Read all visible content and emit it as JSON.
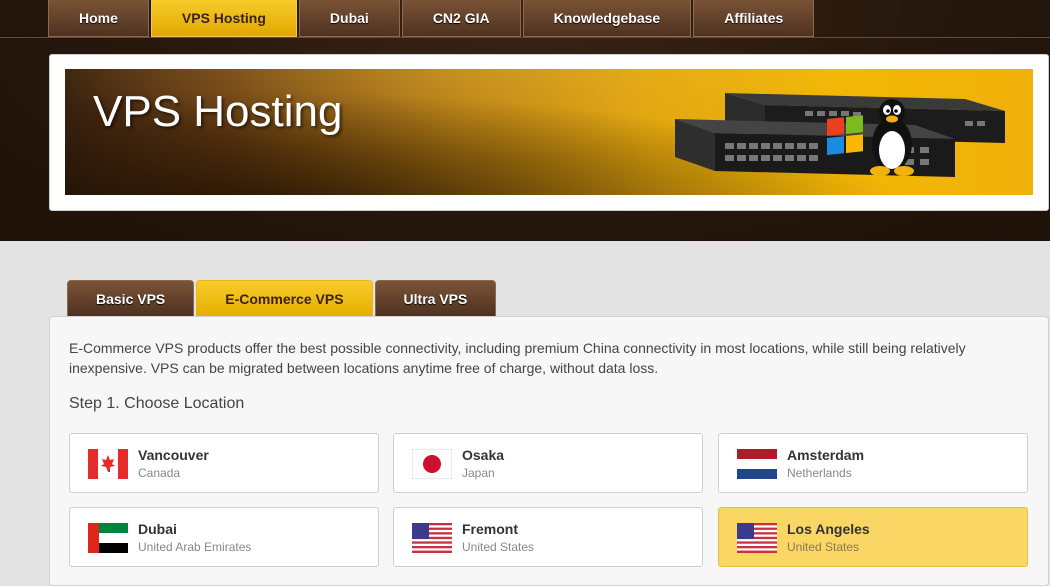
{
  "nav": {
    "items": [
      {
        "label": "Home",
        "active": false
      },
      {
        "label": "VPS Hosting",
        "active": true
      },
      {
        "label": "Dubai",
        "active": false
      },
      {
        "label": "CN2 GIA",
        "active": false
      },
      {
        "label": "Knowledgebase",
        "active": false
      },
      {
        "label": "Affiliates",
        "active": false
      }
    ]
  },
  "banner": {
    "title": "VPS Hosting"
  },
  "product_tabs": [
    {
      "label": "Basic VPS",
      "active": false
    },
    {
      "label": "E-Commerce VPS",
      "active": true
    },
    {
      "label": "Ultra VPS",
      "active": false
    }
  ],
  "content": {
    "description": "E-Commerce VPS products offer the best possible connectivity, including premium China connectivity in most locations, while still being relatively inexpensive. VPS can be migrated between locations anytime free of charge, without data loss.",
    "step_title": "Step 1. Choose Location"
  },
  "locations": [
    {
      "city": "Vancouver",
      "country": "Canada",
      "flag": "canada-flag-icon",
      "selected": false
    },
    {
      "city": "Osaka",
      "country": "Japan",
      "flag": "japan-flag-icon",
      "selected": false
    },
    {
      "city": "Amsterdam",
      "country": "Netherlands",
      "flag": "netherlands-flag-icon",
      "selected": false
    },
    {
      "city": "Dubai",
      "country": "United Arab Emirates",
      "flag": "uae-flag-icon",
      "selected": false
    },
    {
      "city": "Fremont",
      "country": "United States",
      "flag": "usa-flag-icon",
      "selected": false
    },
    {
      "city": "Los Angeles",
      "country": "United States",
      "flag": "usa-flag-icon",
      "selected": true
    }
  ],
  "colors": {
    "accent": "#f2b705",
    "brown_dark": "#2a1a0f",
    "selected_bg": "#fad665"
  }
}
